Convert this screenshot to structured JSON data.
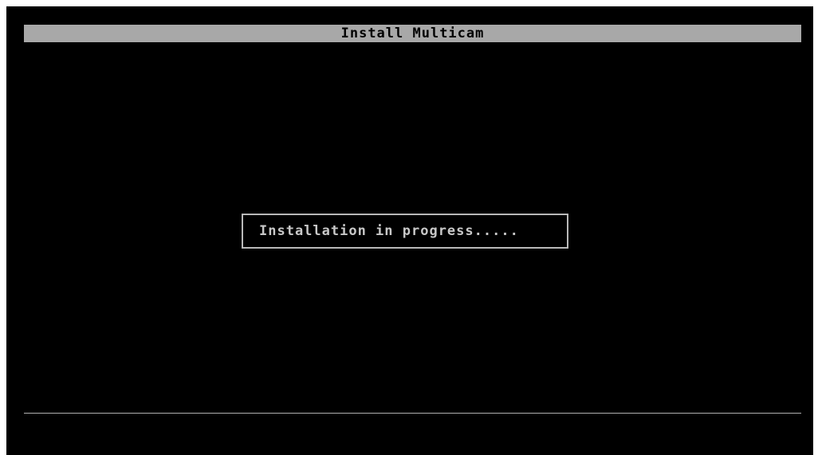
{
  "window": {
    "title": "Install Multicam"
  },
  "status": {
    "message": "Installation in progress....."
  },
  "colors": {
    "background": "#000000",
    "title_bar": "#a8a8a8",
    "text": "#c8c8c8",
    "border": "#b8b8b8"
  }
}
